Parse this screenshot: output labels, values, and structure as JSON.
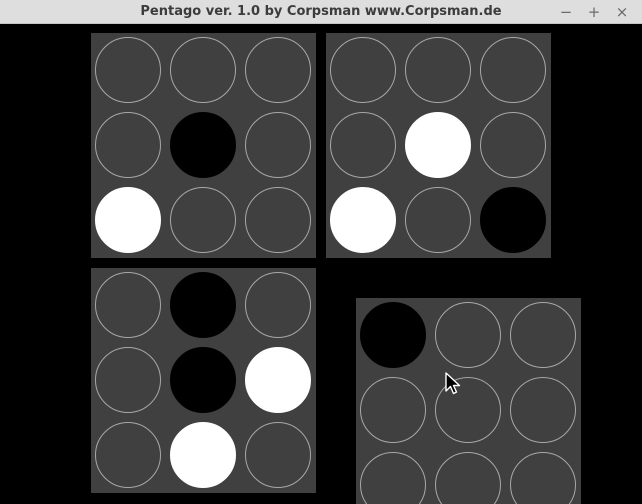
{
  "window": {
    "title": "Pentago ver. 1.0 by Corpsman www.Corpsman.de",
    "minimize_glyph": "−",
    "maximize_glyph": "+",
    "close_glyph": "×"
  },
  "quadrants": [
    {
      "name": "top-left",
      "cells": [
        "empty",
        "empty",
        "empty",
        "empty",
        "black",
        "empty",
        "white",
        "empty",
        "empty"
      ]
    },
    {
      "name": "top-right",
      "cells": [
        "empty",
        "empty",
        "empty",
        "empty",
        "white",
        "empty",
        "white",
        "empty",
        "black"
      ]
    },
    {
      "name": "bottom-left",
      "cells": [
        "empty",
        "black",
        "empty",
        "empty",
        "black",
        "white",
        "empty",
        "white",
        "empty"
      ]
    },
    {
      "name": "bottom-right",
      "cells": [
        "black",
        "empty",
        "empty",
        "empty",
        "empty",
        "empty",
        "empty",
        "empty",
        "empty"
      ]
    }
  ],
  "colors": {
    "background": "#000000",
    "board": "#404040",
    "empty_ring": "#a8a8a8",
    "black_marble": "#000000",
    "white_marble": "#ffffff"
  }
}
